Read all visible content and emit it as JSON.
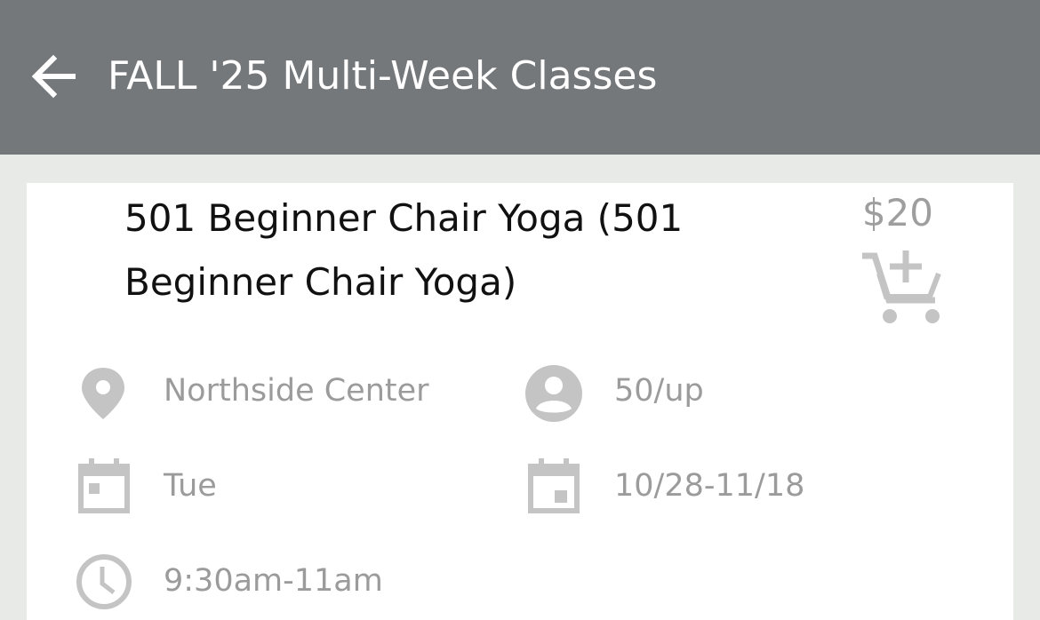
{
  "appbar": {
    "title": "FALL '25 Multi-Week Classes",
    "back_icon": "arrow-left-icon"
  },
  "class": {
    "title": "501 Beginner Chair Yoga (501 Beginner Chair Yoga)",
    "price": "$20",
    "cart_icon": "add-shopping-cart-icon",
    "location": "Northside Center",
    "age": "50/up",
    "day": "Tue",
    "dates": "10/28-11/18",
    "time": "9:30am-11am"
  },
  "colors": {
    "appbar": "#75787b",
    "background": "#e8eae8",
    "card": "#ffffff",
    "icon_gray": "#c4c4c4",
    "text_gray": "#9b9b9b"
  }
}
